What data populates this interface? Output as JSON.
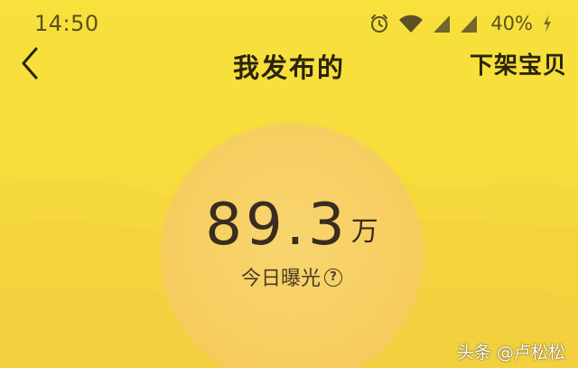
{
  "status_bar": {
    "time": "14:50",
    "battery": "40%",
    "icons": [
      "alarm-icon",
      "wifi-icon",
      "signal-icon",
      "signal-icon",
      "charging-icon"
    ]
  },
  "header": {
    "title": "我发布的",
    "action_label": "下架宝贝",
    "back_icon": "chevron-left-icon"
  },
  "exposure": {
    "value": "89.3",
    "unit": "万",
    "label": "今日曝光",
    "help_icon_text": "?"
  },
  "watermark": "头条 @卢松松",
  "colors": {
    "background": "#f7dd3e",
    "circle": "#f7cf64",
    "text_dark": "#2a230b"
  }
}
